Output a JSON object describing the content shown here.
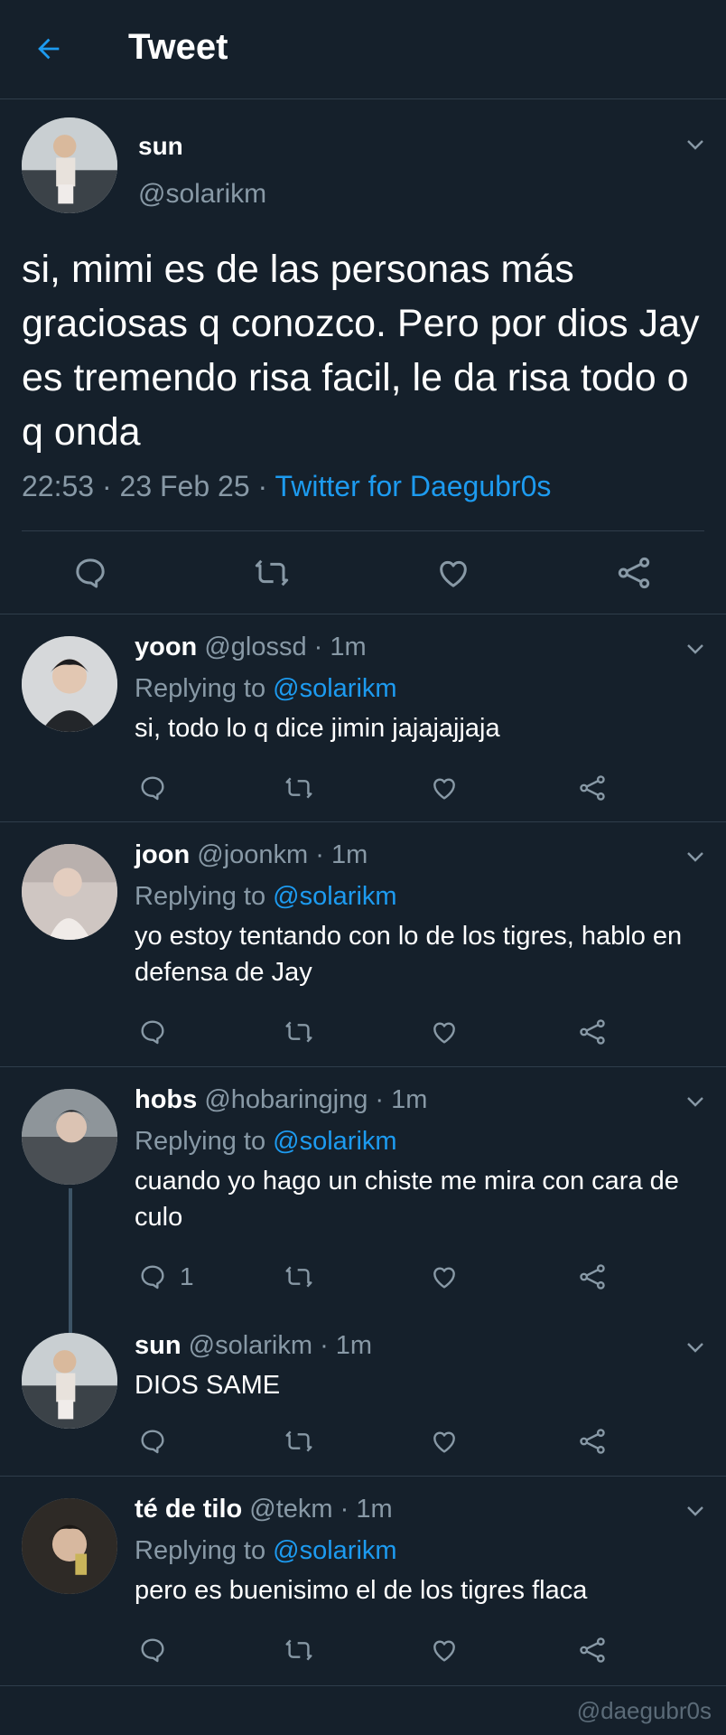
{
  "header": {
    "title": "Tweet",
    "back_icon": "arrow-left-icon"
  },
  "colors": {
    "background": "#15202b",
    "accent": "#1d9bf0",
    "muted": "#8899a6",
    "divider": "#2f3d4b"
  },
  "main_tweet": {
    "name": "sun",
    "handle": "@solarikm",
    "text": "si, mimi es de las personas más graciosas q conozco. Pero por dios Jay es tremendo risa facil, le da risa todo o q onda",
    "time": "22:53 · 23 Feb 25 · ",
    "source": "Twitter for Daegubr0s"
  },
  "replies": [
    {
      "name": "yoon",
      "handle": "@glossd · 1m",
      "replying_label": "Replying to ",
      "replying_to": "@solarikm",
      "text": "si, todo lo q dice jimin jajajajjaja",
      "reply_count": ""
    },
    {
      "name": "joon",
      "handle": "@joonkm · 1m",
      "replying_label": "Replying to ",
      "replying_to": "@solarikm",
      "text": "yo estoy tentando con lo de los tigres, hablo en defensa de Jay",
      "reply_count": ""
    },
    {
      "name": "hobs",
      "handle": "@hobaringjng · 1m",
      "replying_label": "Replying to ",
      "replying_to": "@solarikm",
      "text": "cuando yo hago un chiste me mira con cara de culo",
      "reply_count": "1"
    },
    {
      "name": "sun",
      "handle": "@solarikm · 1m",
      "text": "DIOS SAME",
      "reply_count": ""
    },
    {
      "name": "té de tilo",
      "handle": "@tekm · 1m",
      "replying_label": "Replying to ",
      "replying_to": "@solarikm",
      "text": "pero es buenisimo el de los tigres flaca",
      "reply_count": ""
    }
  ],
  "watermark": "@daegubr0s"
}
